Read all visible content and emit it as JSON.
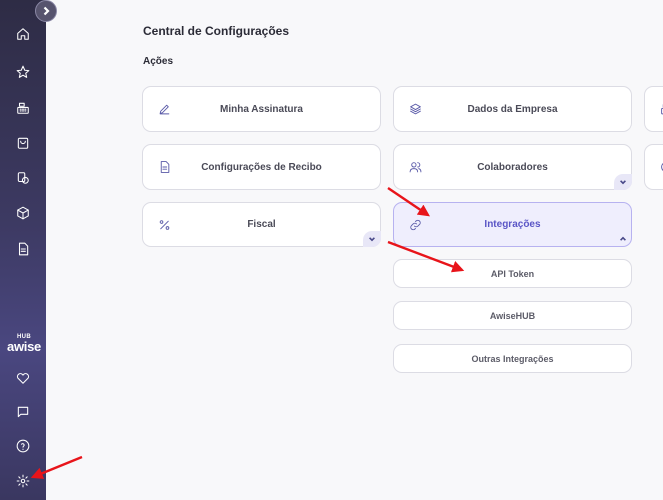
{
  "page": {
    "title": "Central de Configurações",
    "section": "Ações"
  },
  "sidebar": {
    "brand_super": "HUB",
    "brand_name": "awise",
    "items": [
      {
        "icon": "home-icon"
      },
      {
        "icon": "star-icon"
      },
      {
        "icon": "cash-register-icon"
      },
      {
        "icon": "shopping-bag-icon"
      },
      {
        "icon": "coins-icon"
      },
      {
        "icon": "box-icon"
      },
      {
        "icon": "document-icon"
      },
      {
        "icon": "heart-icon"
      },
      {
        "icon": "chat-icon"
      },
      {
        "icon": "help-icon"
      },
      {
        "icon": "settings-icon"
      }
    ]
  },
  "cards": [
    {
      "label": "Minha Assinatura",
      "icon": "pen-icon"
    },
    {
      "label": "Dados da Empresa",
      "icon": "layers-icon"
    },
    {
      "label": "Configurações de Recibo",
      "icon": "document-icon"
    },
    {
      "label": "Colaboradores",
      "icon": "users-icon"
    },
    {
      "label": "Fiscal",
      "icon": "percent-icon"
    },
    {
      "label": "Integrações",
      "icon": "link-icon",
      "active": true
    }
  ],
  "integrations": [
    {
      "label": "API Token"
    },
    {
      "label": "AwiseHUB"
    },
    {
      "label": "Outras Integrações"
    }
  ],
  "colors": {
    "accent": "#5a55c6",
    "sidebar": "#3d3a63",
    "annotation": "#e8141a"
  }
}
